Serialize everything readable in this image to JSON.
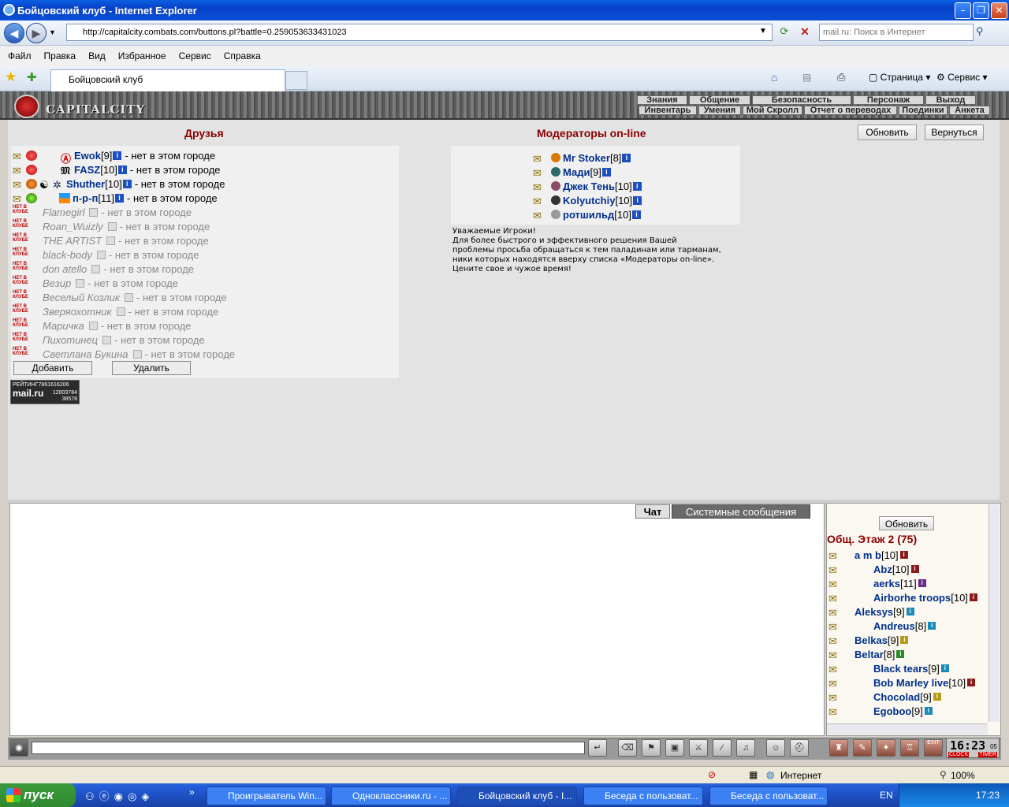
{
  "window": {
    "title": "Бойцовский клуб - Internet Explorer"
  },
  "browser": {
    "url": "http://capitalcity.combats.com/buttons.pl?battle=0.259053633431023",
    "search_placeholder": "mail.ru: Поиск в Интернет",
    "menu": [
      "Файл",
      "Правка",
      "Вид",
      "Избранное",
      "Сервис",
      "Справка"
    ],
    "tab_title": "Бойцовский клуб",
    "page_label": "Страница",
    "tools_label": "Сервис"
  },
  "game": {
    "logo": "CAPITALCITY",
    "top_menu": [
      "Знания",
      "Общение",
      "Безопасность",
      "Персонаж",
      "Выход"
    ],
    "sub_menu": [
      "Инвентарь",
      "Умения",
      "Мой Скролл",
      "Отчет о переводах",
      "Поединки",
      "Анкета"
    ],
    "friends_title": "Друзья",
    "mods_title": "Модераторы on-line",
    "refresh_label": "Обновить",
    "back_label": "Вернуться",
    "add_label": "Добавить",
    "delete_label": "Удалить",
    "not_in_club": "НЕТ В КЛУБЕ",
    "friends_online": [
      {
        "name": "Ewok",
        "level": "[9]",
        "status": " - нет в этом городе"
      },
      {
        "name": "FASZ",
        "level": "[10]",
        "status": " - нет в этом городе"
      },
      {
        "name": "Shuther",
        "level": "[10]",
        "status": " - нет в этом городе"
      },
      {
        "name": "п-р-п",
        "level": "[11]",
        "status": " - нет в этом городе"
      }
    ],
    "friends_offline": [
      {
        "name": "Flamegirl",
        "status": " - нет в этом городе"
      },
      {
        "name": "Roan_Wuizly",
        "status": " - нет в этом городе"
      },
      {
        "name": "THE ARTIST",
        "status": " - нет в этом городе"
      },
      {
        "name": "black-body",
        "status": " - нет в этом городе"
      },
      {
        "name": "don atello",
        "status": " - нет в этом городе"
      },
      {
        "name": "Везир",
        "status": " - нет в этом городе"
      },
      {
        "name": "Веселый Козлик",
        "status": " - нет в этом городе"
      },
      {
        "name": "Зверяохотник",
        "status": " - нет в этом городе"
      },
      {
        "name": "Маричка",
        "status": " - нет в этом городе"
      },
      {
        "name": "Пихотинец",
        "status": " - нет в этом городе"
      },
      {
        "name": "Светлана Букина",
        "status": " - нет в этом городе"
      }
    ],
    "moderators": [
      {
        "name": "Mr Stoker",
        "level": "[8]"
      },
      {
        "name": "Мади",
        "level": "[9]"
      },
      {
        "name": "Джек Тень",
        "level": "[10]"
      },
      {
        "name": "Kolyutchiy",
        "level": "[10]"
      },
      {
        "name": "ротшильд",
        "level": "[10]"
      }
    ],
    "mods_note": [
      "Уважаемые Игроки!",
      "Для более быстрого и эффективного решения Вашей",
      "проблемы просьба обращаться к тем паладинам или тарманам,",
      "ники которых находятся вверху списка «Модераторы on-line».",
      "Цените свое и чужое время!"
    ],
    "counter": {
      "label": "РЕЙТИНГ",
      "value1": "7861616206",
      "value2": "12003784",
      "value3": "38578",
      "brand": "mail.ru"
    },
    "chat_tab": "Чат",
    "system_tab": "Системные сообщения",
    "online_refresh": "Обновить",
    "room_title": "Общ. Этаж 2 (75)",
    "online": [
      {
        "name": "a m b",
        "level": "[10]"
      },
      {
        "name": "Abz",
        "level": "[10]"
      },
      {
        "name": "aerks",
        "level": "[11]"
      },
      {
        "name": "Airborhe troops",
        "level": "[10]"
      },
      {
        "name": "Aleksys",
        "level": "[9]"
      },
      {
        "name": "Andreus",
        "level": "[8]"
      },
      {
        "name": "Belkas",
        "level": "[9]"
      },
      {
        "name": "Beltar",
        "level": "[8]"
      },
      {
        "name": "Black tears",
        "level": "[9]"
      },
      {
        "name": "Bob Marley live",
        "level": "[10]"
      },
      {
        "name": "Chocolad",
        "level": "[9]"
      },
      {
        "name": "Egoboo",
        "level": "[9]"
      }
    ],
    "clock": "16:23",
    "clock_sec": "05",
    "clock_label": "CLOCK",
    "timer_label": "TIMER",
    "exit_label": "EXIT"
  },
  "statusbar": {
    "zone": "Интернет",
    "zoom": "100%"
  },
  "taskbar": {
    "start": "пуск",
    "tasks": [
      "Проигрыватель Win...",
      "Одноклассники.ru - ...",
      "Бойцовский клуб - I...",
      "Беседа с пользоват...",
      "Беседа с пользоват..."
    ],
    "lang": "EN",
    "time": "17:23"
  }
}
